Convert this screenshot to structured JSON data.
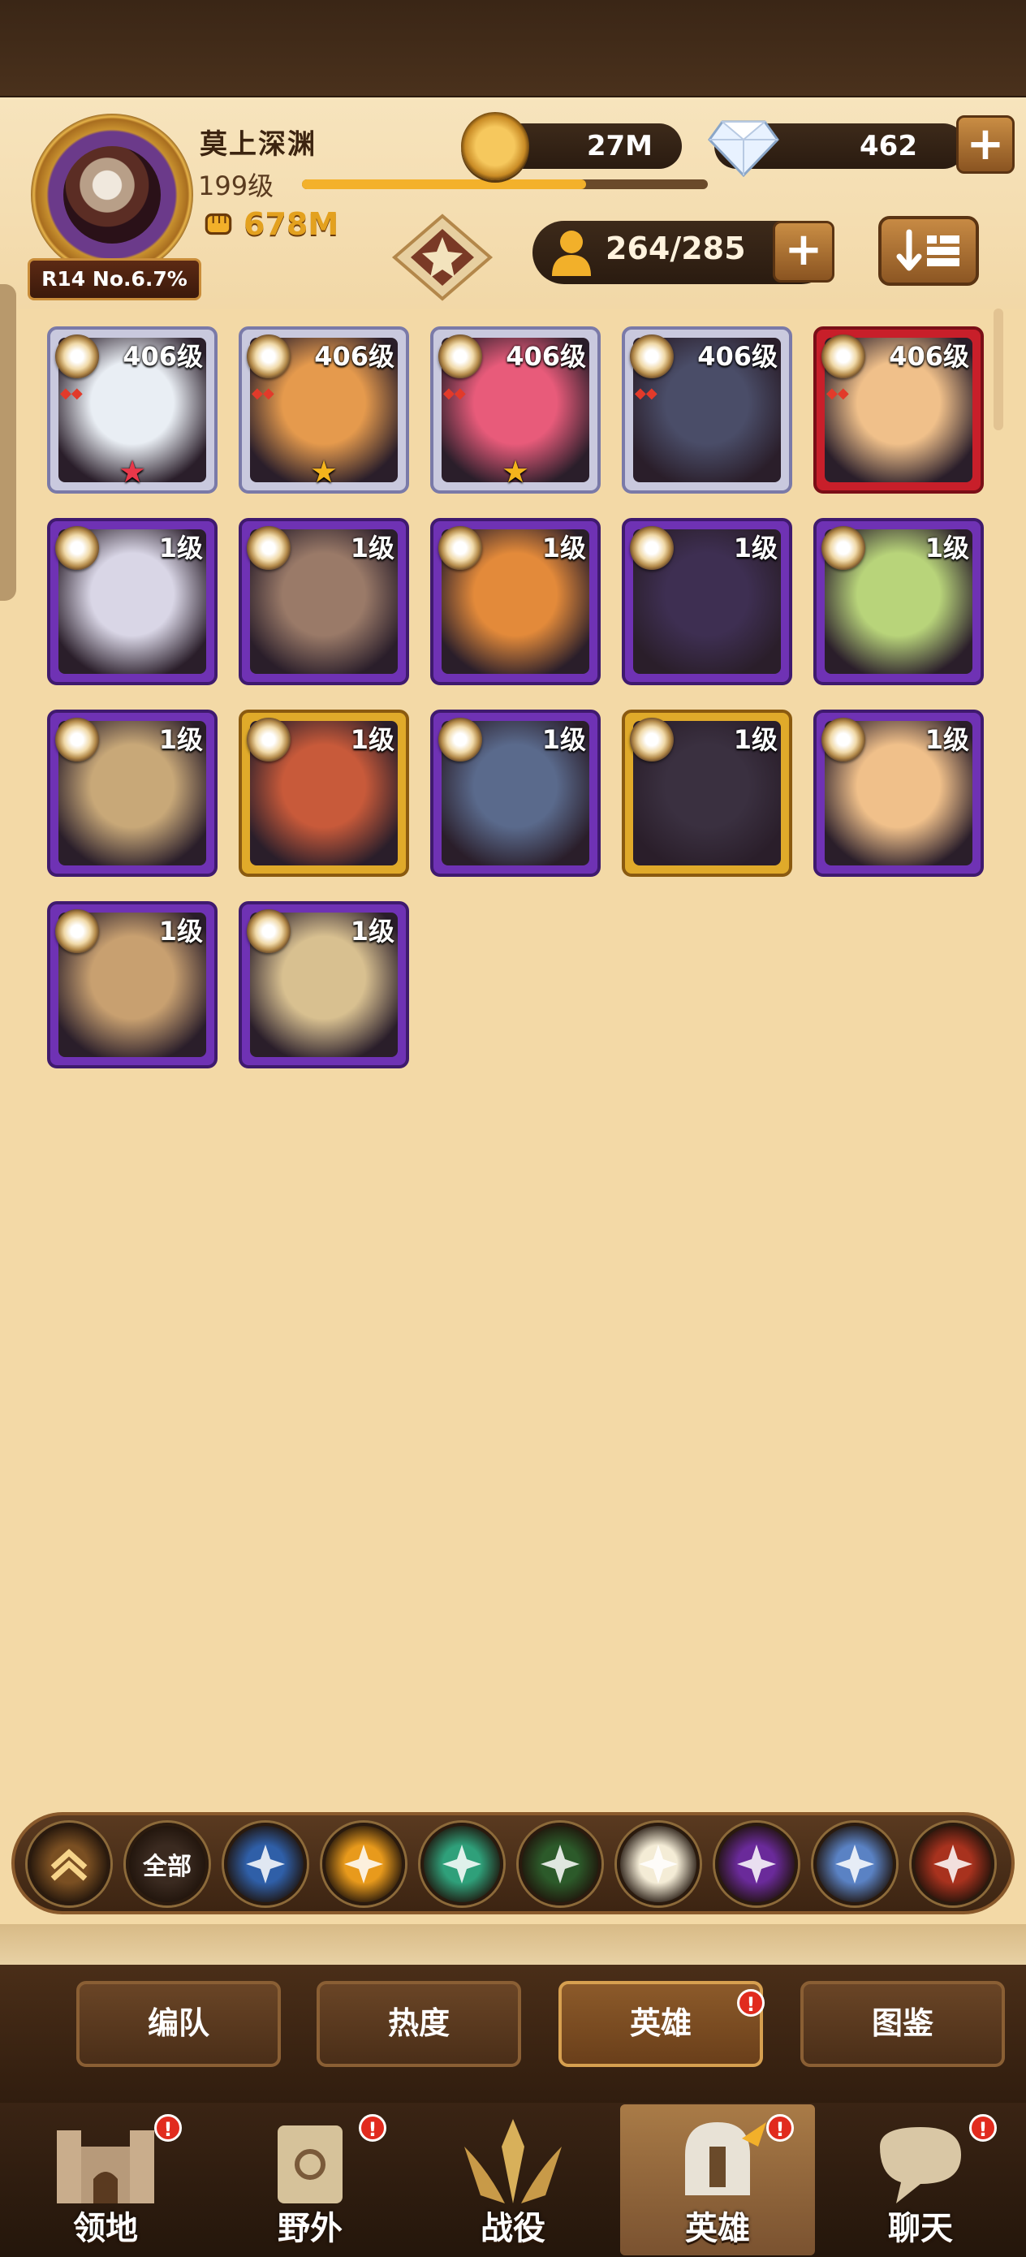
{
  "player": {
    "name": "莫上深渊",
    "level": "199级",
    "power": "678M",
    "rank_badge": "R14 No.6.7%",
    "xp_progress": 0.7
  },
  "currencies": {
    "gold": "27M",
    "gems": "462",
    "gems_plus": "+"
  },
  "roster": {
    "capacity": "264/285",
    "capacity_plus": "+"
  },
  "heroes": [
    {
      "level": "406级",
      "frame": "silver",
      "star": "red",
      "art": "#e9eef4"
    },
    {
      "level": "406级",
      "frame": "silver",
      "star": "gold",
      "art": "#e59a4d"
    },
    {
      "level": "406级",
      "frame": "silver",
      "star": "gold",
      "art": "#e85b7a"
    },
    {
      "level": "406级",
      "frame": "silver",
      "star": "none",
      "art": "#4a4d68"
    },
    {
      "level": "406级",
      "frame": "red",
      "star": "none",
      "art": "#f0c08a"
    },
    {
      "level": "1级",
      "frame": "purple",
      "star": "none",
      "art": "#d9d6e6"
    },
    {
      "level": "1级",
      "frame": "purple",
      "star": "none",
      "art": "#9a7a68"
    },
    {
      "level": "1级",
      "frame": "purple",
      "star": "none",
      "art": "#e38a3a"
    },
    {
      "level": "1级",
      "frame": "purple",
      "star": "none",
      "art": "#3e2f52"
    },
    {
      "level": "1级",
      "frame": "purple",
      "star": "none",
      "art": "#b8d47a"
    },
    {
      "level": "1级",
      "frame": "purple",
      "star": "none",
      "art": "#c8a878"
    },
    {
      "level": "1级",
      "frame": "gold",
      "star": "none",
      "art": "#c85a3a"
    },
    {
      "level": "1级",
      "frame": "purple",
      "star": "none",
      "art": "#5a6a8c"
    },
    {
      "level": "1级",
      "frame": "gold",
      "star": "none",
      "art": "#3a3040"
    },
    {
      "level": "1级",
      "frame": "purple",
      "star": "none",
      "art": "#f0c08a"
    },
    {
      "level": "1级",
      "frame": "purple",
      "star": "none",
      "art": "#c8a070"
    },
    {
      "level": "1级",
      "frame": "purple",
      "star": "none",
      "art": "#d8c090"
    }
  ],
  "filters": [
    {
      "id": "collapse",
      "label": "",
      "color": "#7a4f22"
    },
    {
      "id": "all",
      "label": "全部",
      "color": "#3a2a20"
    },
    {
      "id": "lightbearer",
      "label": "",
      "color": "#2f5fa8"
    },
    {
      "id": "mauler",
      "label": "",
      "color": "#e89a1c"
    },
    {
      "id": "wilder",
      "label": "",
      "color": "#2fa07a"
    },
    {
      "id": "graveborn",
      "label": "",
      "color": "#2c5a2a"
    },
    {
      "id": "celestial",
      "label": "",
      "color": "#f4ecd6"
    },
    {
      "id": "hypogean",
      "label": "",
      "color": "#6a2a9a"
    },
    {
      "id": "dimensional",
      "label": "",
      "color": "#5a82c4"
    },
    {
      "id": "fire",
      "label": "",
      "color": "#a8321e"
    }
  ],
  "subtabs": [
    {
      "label": "编队",
      "badge": ""
    },
    {
      "label": "热度",
      "badge": ""
    },
    {
      "label": "英雄",
      "badge": "!"
    },
    {
      "label": "图鉴",
      "badge": ""
    }
  ],
  "nav": [
    {
      "label": "领地",
      "badge": "!"
    },
    {
      "label": "野外",
      "badge": "!"
    },
    {
      "label": "战役",
      "badge": ""
    },
    {
      "label": "英雄",
      "badge": "!"
    },
    {
      "label": "聊天",
      "badge": "!"
    }
  ]
}
